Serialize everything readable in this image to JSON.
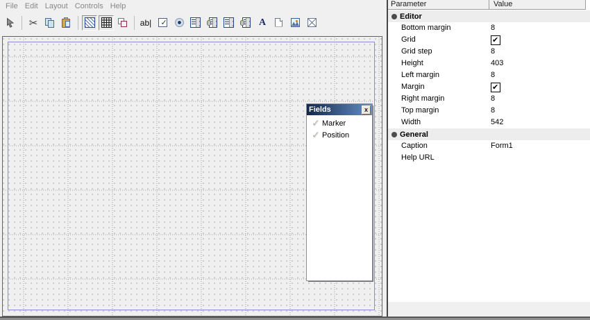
{
  "menu": {
    "items": [
      "File",
      "Edit",
      "Layout",
      "Controls",
      "Help"
    ]
  },
  "toolbar": {
    "buttons": [
      {
        "icon": "pointer-icon",
        "disabled": true
      },
      {
        "separator": true
      },
      {
        "icon": "cut-icon"
      },
      {
        "icon": "copy-icon"
      },
      {
        "icon": "paste-icon"
      },
      {
        "separator": true
      },
      {
        "icon": "margin-hatch-icon",
        "pressed": true
      },
      {
        "icon": "grid-icon",
        "pressed": true
      },
      {
        "icon": "order-overlap-icon"
      },
      {
        "separator": true
      },
      {
        "icon": "edit-ab-icon",
        "glyph": "ab|"
      },
      {
        "icon": "checkbox-icon"
      },
      {
        "icon": "radio-icon"
      },
      {
        "icon": "listbox-icon"
      },
      {
        "icon": "db-listbox-icon"
      },
      {
        "icon": "combobox-icon"
      },
      {
        "icon": "db-combobox-icon"
      },
      {
        "icon": "label-icon",
        "glyph": "A"
      },
      {
        "icon": "panel-icon"
      },
      {
        "icon": "image-icon"
      },
      {
        "icon": "frame-icon"
      }
    ]
  },
  "fields_palette": {
    "title": "Fields",
    "close_glyph": "x",
    "items": [
      {
        "label": "Marker"
      },
      {
        "label": "Position"
      }
    ]
  },
  "properties": {
    "columns": [
      "Parameter",
      "Value"
    ],
    "sections": [
      {
        "label": "Editor",
        "rows": [
          {
            "param": "Bottom margin",
            "value": "8"
          },
          {
            "param": "Grid",
            "type": "checkbox",
            "checked": true
          },
          {
            "param": "Grid step",
            "value": "8"
          },
          {
            "param": "Height",
            "value": "403"
          },
          {
            "param": "Left margin",
            "value": "8"
          },
          {
            "param": "Margin",
            "type": "checkbox",
            "checked": true
          },
          {
            "param": "Right margin",
            "value": "8"
          },
          {
            "param": "Top margin",
            "value": "8"
          },
          {
            "param": "Width",
            "value": "542"
          }
        ]
      },
      {
        "label": "General",
        "rows": [
          {
            "param": "Caption",
            "value": "Form1"
          },
          {
            "param": "Help URL",
            "value": ""
          }
        ]
      }
    ]
  },
  "colors": {
    "app_background": "#f0f0f0",
    "form_margin_outline": "#8a8ad8",
    "palette_title_gradient_start": "#14284c",
    "palette_title_gradient_end": "#6490c4",
    "grid_dot": "#9a9a9a"
  }
}
